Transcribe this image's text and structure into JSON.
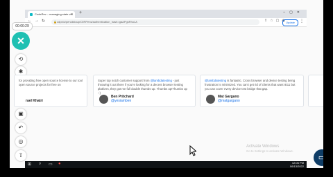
{
  "recorder": {
    "time": "00:00:29"
  },
  "browser": {
    "tab_title": "CodeRev – managing state via",
    "url": "cdpnio/pencilstoup/OIRPens/authentication_hash=gaAPgkRhoLA",
    "update_label": "Update"
  },
  "cards": [
    {
      "quote": "for providing free open source license to our tool open source projects for free on",
      "name": "rael Khatri",
      "handle": ""
    },
    {
      "quote_pre": "Super top notch customer support from ",
      "mention": "@lambdatesting",
      "quote_post": " - just throwing it out there if you're looking for a decent browser testing platform, they got me full double thumbs up. Thumbs up!Thumbs up :-)",
      "name": "Ben Pritchard",
      "handle": "@yesiamben"
    },
    {
      "mention": "@lambdatesting",
      "quote_post": " is fantastic. Cross browser and device testing being frustration is minimized. You can't get rid of clients that want IE11 but you can cover every device test bridge that gap.",
      "name": "Mat Gargano",
      "handle": "@matgargano"
    }
  ],
  "watermark": {
    "line1": "Activate Windows",
    "line2": "Go to Settings to activate Windows."
  },
  "taskbar": {
    "time": "12:06 PM",
    "date": "06/13/2022"
  },
  "icons": [
    "close-icon",
    "rotate-icon",
    "bug-icon",
    "camera-icon",
    "document-icon",
    "chat-icon",
    "refresh-icon",
    "location-icon",
    "upload-icon",
    "chat-bubble-icon"
  ]
}
